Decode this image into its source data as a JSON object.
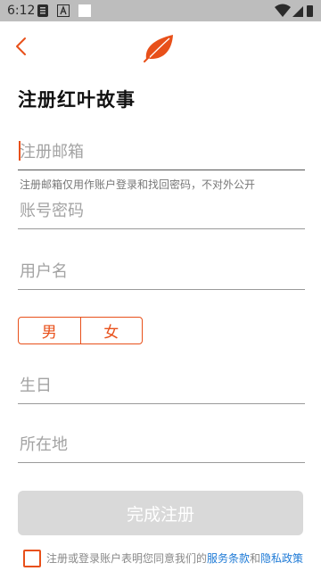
{
  "status_bar": {
    "time": "6:12"
  },
  "colors": {
    "accent": "#e8501a",
    "link": "#1e7ad6",
    "button_disabled": "#d9d9d9"
  },
  "header": {
    "title": "注册红叶故事"
  },
  "form": {
    "email_placeholder": "注册邮箱",
    "email_hint": "注册邮箱仅用作账户登录和找回密码，不对外公开",
    "password_placeholder": "账号密码",
    "username_placeholder": "用户名",
    "gender_male": "男",
    "gender_female": "女",
    "birthday_placeholder": "生日",
    "location_placeholder": "所在地",
    "submit_label": "完成注册"
  },
  "agreement": {
    "prefix": "注册或登录账户表明您同意我们的",
    "terms_link": "服务条款",
    "and": "和",
    "privacy_link": "隐私政策"
  }
}
